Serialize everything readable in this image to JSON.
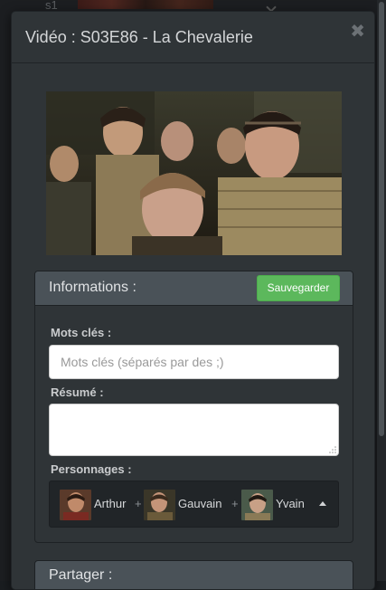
{
  "background": {
    "row_label": "s1"
  },
  "modal": {
    "title": "Vidéo : S03E86 - La Chevalerie",
    "close_symbol": "✖"
  },
  "info_panel": {
    "title": "Informations :",
    "save_label": "Sauvegarder",
    "keywords_label": "Mots clés :",
    "keywords_placeholder": "Mots clés (séparés par des ;)",
    "keywords_value": "",
    "summary_label": "Résumé :",
    "summary_value": "",
    "characters_label": "Personnages :",
    "characters": [
      {
        "name": "Arthur"
      },
      {
        "name": "Gauvain"
      },
      {
        "name": "Yvain"
      }
    ],
    "separator": "+"
  },
  "share_panel": {
    "title": "Partager :"
  },
  "colors": {
    "save_button": "#5cb85c",
    "panel_heading": "#4a5258",
    "modal_bg": "#2f3437"
  },
  "icons": {
    "close": "close-icon",
    "caret": "caret-up-icon",
    "resize": "resize-grip-icon"
  }
}
